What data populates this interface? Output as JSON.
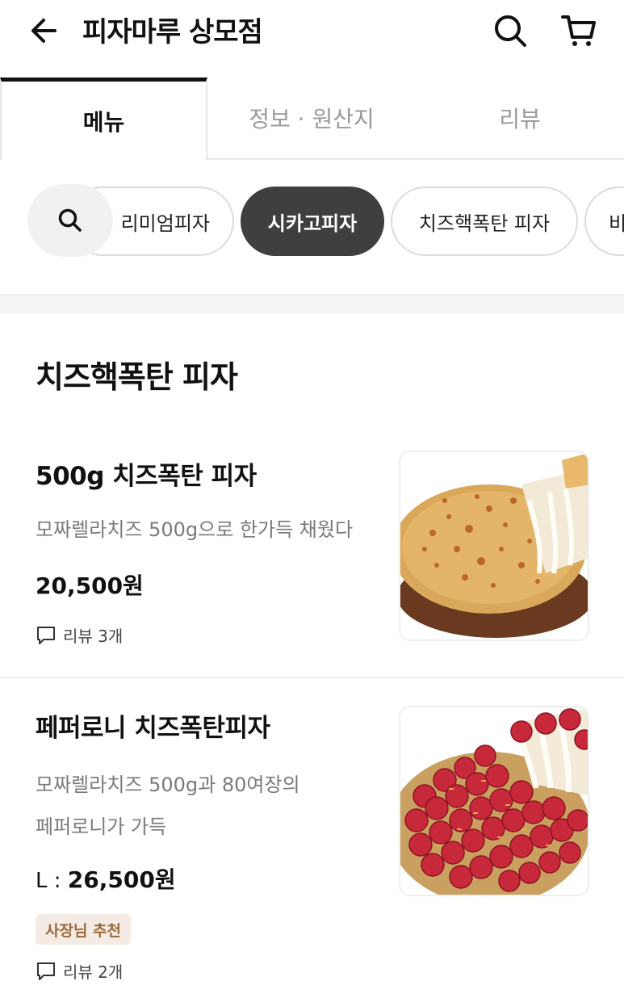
{
  "header": {
    "title": "피자마루 상모점",
    "back_icon": "arrow-left-icon",
    "search_icon": "search-icon",
    "cart_icon": "cart-icon"
  },
  "tabs": [
    {
      "label": "메뉴",
      "active": true
    },
    {
      "label": "정보 · 원산지",
      "active": false
    },
    {
      "label": "리뷰",
      "active": false
    }
  ],
  "categories": {
    "search_icon": "search-icon",
    "chips": [
      {
        "label": "리미엄피자",
        "active": false
      },
      {
        "label": "시카고피자",
        "active": true
      },
      {
        "label": "치즈핵폭탄 피자",
        "active": false
      },
      {
        "label": "비",
        "active": false
      }
    ]
  },
  "section": {
    "title": "치즈핵폭탄 피자"
  },
  "items": [
    {
      "name": "500g 치즈폭탄 피자",
      "description": "모짜렐라치즈 500g으로 한가득 채웠다",
      "price_prefix": "",
      "price": "20,500원",
      "review": "리뷰 3개",
      "image": "cheese-pizza-photo"
    },
    {
      "name": "페퍼로니 치즈폭탄피자",
      "description_line1": "모짜렐라치즈 500g과 80여장의",
      "description_line2": "페퍼로니가 가득",
      "price_prefix": "L : ",
      "price": "26,500원",
      "badge": "사장님 추천",
      "review": "리뷰 2개",
      "image": "pepperoni-pizza-photo"
    }
  ],
  "colors": {
    "active_chip": "#3f3f3f",
    "badge_bg": "#f4ece4",
    "badge_text": "#9a6a3c"
  }
}
